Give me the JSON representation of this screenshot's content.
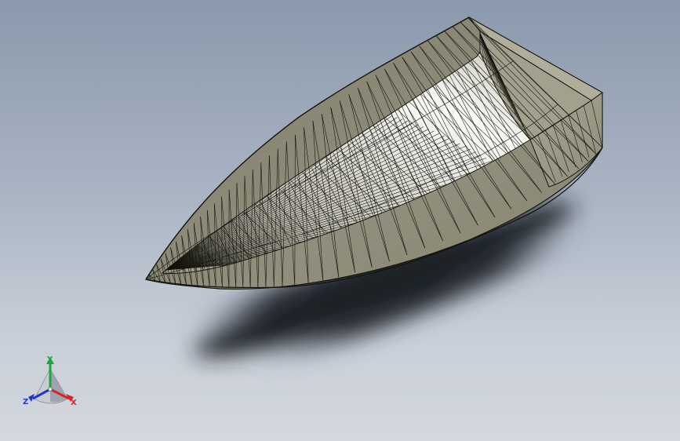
{
  "viewport": {
    "model": "boat-hull-mesh",
    "background_top": "#8b99ad",
    "background_bottom": "#d4d8de",
    "hull_color": "#8e8c78",
    "interior_light": "#f4f4f2",
    "mesh_color": "#15150f"
  },
  "triad": {
    "y_label": "Y",
    "x_label": "X",
    "z_label": "Z",
    "y_color": "#18a83a",
    "x_color": "#d8252a",
    "z_color": "#2438c8"
  }
}
